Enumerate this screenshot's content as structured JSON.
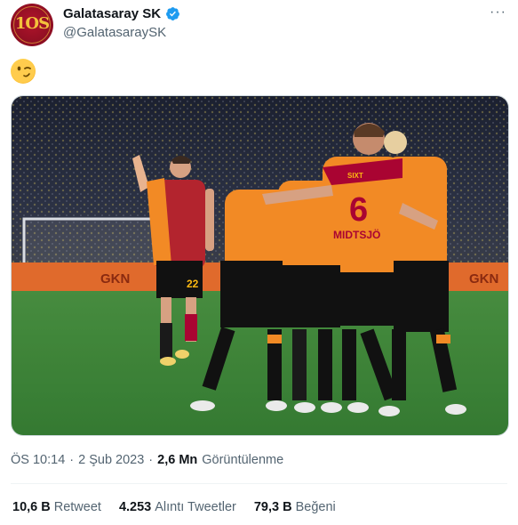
{
  "author": {
    "avatar_text": "1OS",
    "avatar_small": "CUMHURİYETİN 100'Ü",
    "display_name": "Galatasaray SK",
    "handle": "@GalatasaraySK"
  },
  "tweet": {
    "emoji": "😉",
    "time": "ÖS 10:14",
    "separator": "·",
    "date": "2 Şub 2023",
    "views_count": "2,6 Mn",
    "views_label": "Görüntülenme"
  },
  "photo": {
    "ad_board_left": "GKN",
    "ad_board_right": "GKN",
    "jersey_number": "6",
    "jersey_name": "MIDTSJÖ",
    "sponsor": "SIXT",
    "player_left_number": "22"
  },
  "stats": [
    {
      "count": "10,6 B",
      "label": "Retweet"
    },
    {
      "count": "4.253",
      "label": "Alıntı Tweetler"
    },
    {
      "count": "79,3 B",
      "label": "Beğeni"
    }
  ],
  "colors": {
    "verified": "#1d9bf0",
    "galatasaray_red": "#a90432",
    "galatasaray_yellow": "#fdb912",
    "pitch": "#3f8a3c"
  }
}
